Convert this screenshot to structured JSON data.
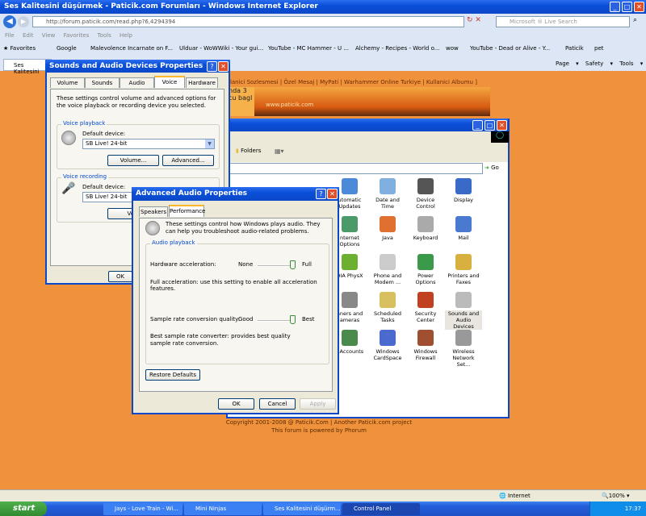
{
  "browser": {
    "title": "Ses Kalitesini düşürmek - Paticik.com Forumları - Windows Internet Explorer",
    "url": "http://forum.paticik.com/read.php?6,4294394",
    "search_placeholder": "Microsoft ® Live Search",
    "menu": [
      "File",
      "Edit",
      "View",
      "Favorites",
      "Tools",
      "Help"
    ],
    "favorites_label": "Favorites",
    "favorites": [
      "Google",
      "Malevolence Incarnate on F...",
      "Ulduar - WoWWiki - Your gui...",
      "YouTube - MC Hammer - U ...",
      "Alchemy - Recipes - World o...",
      "wow",
      "YouTube - Dead or Alive - Y...",
      "Paticik",
      "pet"
    ],
    "tab_label": "Ses Kalitesini",
    "command_bar": [
      "Page ▾",
      "Safety ▾",
      "Tools ▾"
    ],
    "status_zone": "Internet",
    "zoom": "100%"
  },
  "forum": {
    "nav": "llanici Sozlesmesi | Özel Mesaj | MyPati | Warhammer Online Turkiye | Kullanici Albumu ]",
    "side_text": [
      "nda 3",
      "cu bagl"
    ],
    "banner_text": "www.paticik.com",
    "footer": [
      "Copyright 2001-2008 @ Paticik.Com | Another Paticik.com project",
      "This forum is powered by Phorum"
    ]
  },
  "control_panel": {
    "folders_label": "Folders",
    "go_label": "Go",
    "items": [
      [
        "utomatic Updates",
        "Date and Time",
        "Device Control",
        "Display"
      ],
      [
        "nternet Options",
        "Java",
        "Keyboard",
        "Mail"
      ],
      [
        "DIA PhysX",
        "Phone and Modem ...",
        "Power Options",
        "Printers and Faxes"
      ],
      [
        "nners and ameras",
        "Scheduled Tasks",
        "Security Center",
        "Sounds and Audio Devices"
      ],
      [
        "r Accounts",
        "Windows CardSpace",
        "Windows Firewall",
        "Wireless Network Set..."
      ]
    ]
  },
  "sounds_dialog": {
    "title": "Sounds and Audio Devices Properties",
    "tabs": [
      "Volume",
      "Sounds",
      "Audio",
      "Voice",
      "Hardware"
    ],
    "description": "These settings control volume and advanced options for the voice playback or recording device you selected.",
    "playback_group": "Voice playback",
    "recording_group": "Voice recording",
    "default_device_label": "Default device:",
    "playback_device": "SB Live! 24-bit",
    "recording_device": "SB Live! 24-bit",
    "volume_button": "Volume...",
    "advanced_button": "Advanced...",
    "volume_button2": "Volu",
    "ok_button": "OK"
  },
  "advanced_dialog": {
    "title": "Advanced Audio Properties",
    "tabs": [
      "Speakers",
      "Performance"
    ],
    "description": "These settings control how Windows plays audio. They can help you troubleshoot audio-related problems.",
    "group": "Audio playback",
    "hw_label": "Hardware acceleration:",
    "hw_min": "None",
    "hw_max": "Full",
    "hw_level": 1.0,
    "hw_desc": "Full acceleration: use this setting to enable all acceleration features.",
    "src_label": "Sample rate conversion quality:",
    "src_min": "Good",
    "src_max": "Best",
    "src_level": 1.0,
    "src_desc": "Best sample rate converter:  provides best quality sample rate conversion.",
    "restore_button": "Restore Defaults",
    "ok_button": "OK",
    "cancel_button": "Cancel",
    "apply_button": "Apply"
  },
  "taskbar": {
    "start": "start",
    "tasks": [
      "Jays - Love Train - Wi...",
      "Mini Ninjas",
      "Ses Kalitesini düşürm...",
      "Control Panel"
    ],
    "clock": "17:37"
  }
}
